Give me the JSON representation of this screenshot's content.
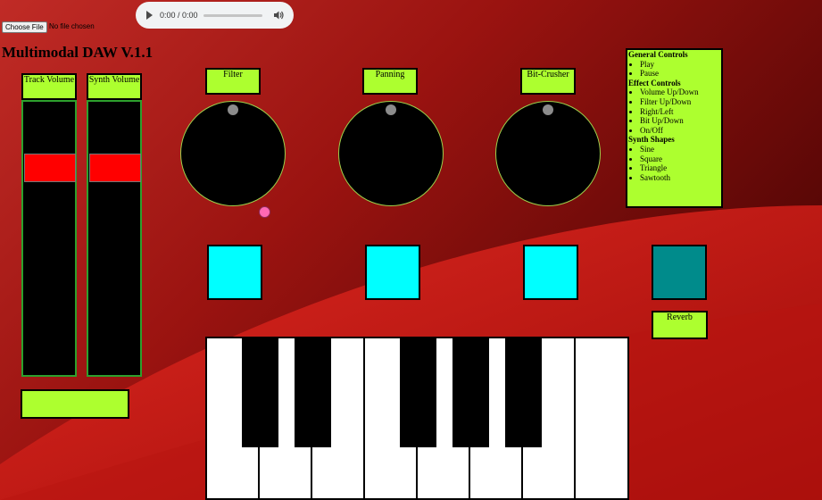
{
  "app": {
    "title": "Multimodal DAW V.1.1"
  },
  "file_input": {
    "button_label": "Choose File",
    "status": "No file chosen"
  },
  "audio_player": {
    "time": "0:00 / 0:00"
  },
  "sliders": [
    {
      "label": "Track Volume"
    },
    {
      "label": "Synth Volume"
    }
  ],
  "knobs": [
    {
      "label": "Filter"
    },
    {
      "label": "Panning"
    },
    {
      "label": "Bit-Crusher"
    }
  ],
  "effect_pads": [
    {
      "state": "off"
    },
    {
      "state": "off"
    },
    {
      "state": "off"
    },
    {
      "state": "on"
    }
  ],
  "reverb": {
    "label": "Reverb"
  },
  "controls_panel": {
    "general_heading": "General Controls",
    "general_items": [
      "Play",
      "Pause"
    ],
    "effect_heading": "Effect Controls",
    "effect_items": [
      "Volume Up/Down",
      "Filter Up/Down",
      "Right/Left",
      "Bit Up/Down",
      "On/Off"
    ],
    "shapes_heading": "Synth Shapes",
    "shape_items": [
      "Sine",
      "Square",
      "Triangle",
      "Sawtooth"
    ]
  },
  "piano": {
    "white_keys": 8,
    "black_keys": 5
  },
  "colors": {
    "background_red": "#8e1010",
    "label_green": "#adff2f",
    "slider_border": "#2da02d",
    "slider_thumb": "#ff0000",
    "pad_off": "#00ffff",
    "pad_on": "#008b8b",
    "knob_indicator": "#8c8c8c",
    "cursor_dot": "#ff69b4"
  },
  "icons": {
    "play": "play-icon",
    "volume": "volume-icon"
  }
}
